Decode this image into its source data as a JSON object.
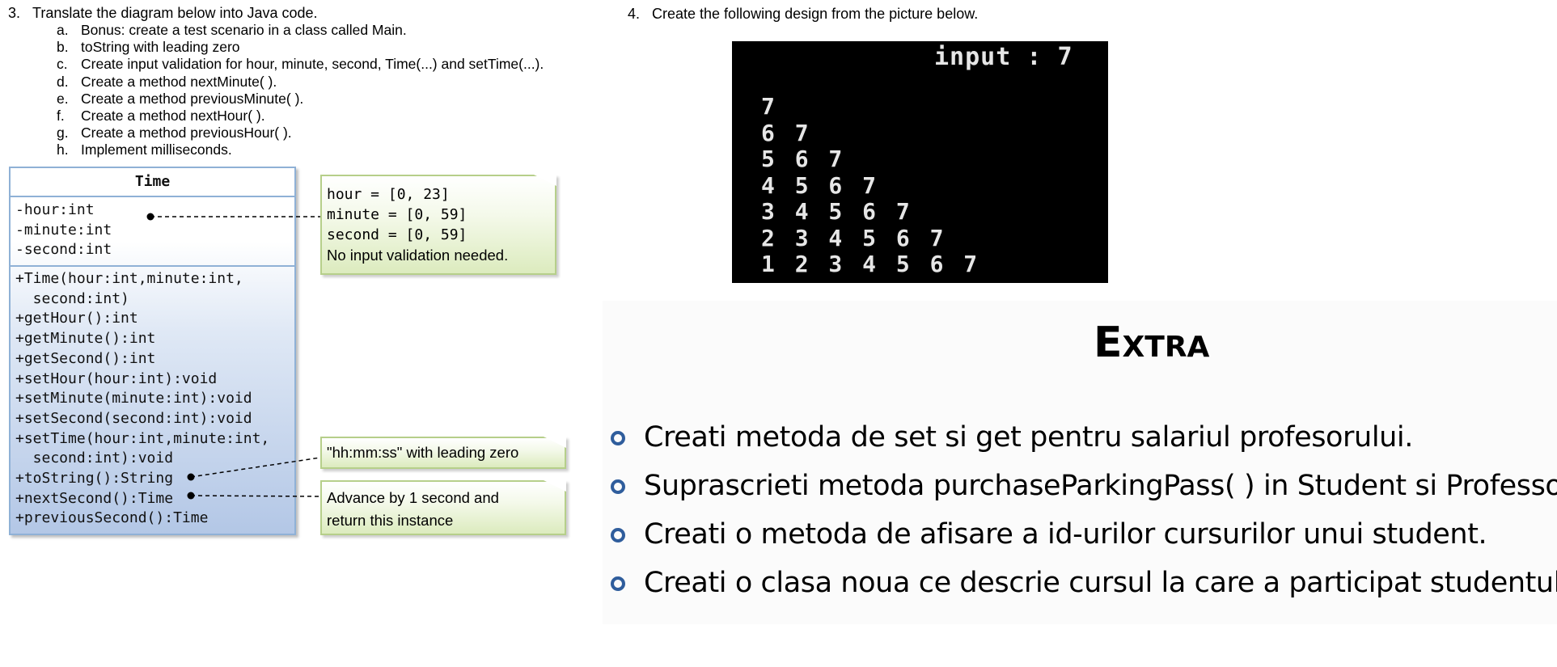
{
  "task3": {
    "number": "3.",
    "title": "Translate the diagram below into Java code.",
    "items": [
      {
        "letter": "a.",
        "text": "Bonus: create a test scenario in a class called Main."
      },
      {
        "letter": "b.",
        "text": "toString with leading zero"
      },
      {
        "letter": "c.",
        "text": "Create input validation for hour, minute, second, Time(...) and setTime(...)."
      },
      {
        "letter": "d.",
        "text": "Create a method nextMinute( )."
      },
      {
        "letter": "e.",
        "text": "Create a method previousMinute( )."
      },
      {
        "letter": "f.",
        "text": "Create a method nextHour( )."
      },
      {
        "letter": "g.",
        "text": "Create a method previousHour( )."
      },
      {
        "letter": "h.",
        "text": "Implement milliseconds."
      }
    ]
  },
  "uml": {
    "class_name": "Time",
    "attributes": [
      "-hour:int",
      "-minute:int",
      "-second:int"
    ],
    "methods": [
      "+Time(hour:int,minute:int,",
      "  second:int)",
      "+getHour():int",
      "+getMinute():int",
      "+getSecond():int",
      "+setHour(hour:int):void",
      "+setMinute(minute:int):void",
      "+setSecond(second:int):void",
      "+setTime(hour:int,minute:int,",
      "  second:int):void",
      "+toString():String",
      "+nextSecond():Time",
      "+previousSecond():Time"
    ]
  },
  "notes": {
    "validation": {
      "lines": [
        "hour = [0, 23]",
        "minute = [0, 59]",
        "second = [0, 59]"
      ],
      "footer": "No input validation needed."
    },
    "tostring": "\"hh:mm:ss\" with leading zero",
    "nextsecond": [
      "Advance by 1 second and",
      "return this instance"
    ]
  },
  "task4": {
    "number": "4.",
    "title": "Create the following design from the picture below.",
    "terminal": {
      "input_line": "input : 7",
      "rows": [
        "7",
        "6 7",
        "5 6 7",
        "4 5 6 7",
        "3 4 5 6 7",
        "2 3 4 5 6 7",
        "1 2 3 4 5 6 7"
      ]
    }
  },
  "extra": {
    "title": "Extra",
    "bullets": [
      "Creati metoda de set si get pentru salariul profesorului.",
      "Suprascrieti metoda purchaseParkingPass( ) in Student si Professor.",
      "Creati o metoda de afisare a id-urilor cursurilor unui student.",
      "Creati o clasa noua ce descrie cursul la care a participat studentul."
    ],
    "bullet_color": "#2f5d9c"
  }
}
